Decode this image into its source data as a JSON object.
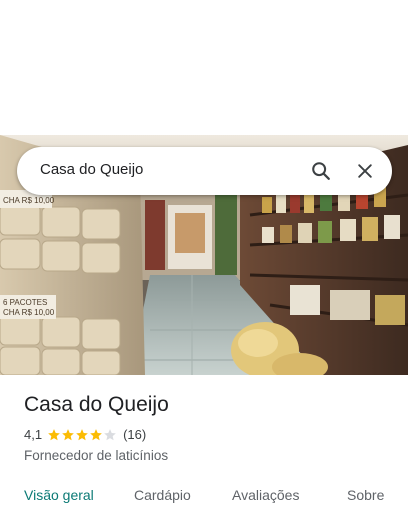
{
  "search": {
    "query": "Casa do Queijo",
    "search_icon": "search-icon",
    "close_icon": "close-icon"
  },
  "photo": {
    "signs": [
      "6 PACOTES",
      "CHA R$ 10,00"
    ],
    "subject": "store-interior-photo"
  },
  "place": {
    "name": "Casa do Queijo",
    "rating": "4,1",
    "rating_value": 4.1,
    "review_count": "(16)",
    "category": "Fornecedor de laticínios"
  },
  "tabs": [
    {
      "label": "Visão geral",
      "active": true
    },
    {
      "label": "Cardápio",
      "active": false
    },
    {
      "label": "Avaliações",
      "active": false
    },
    {
      "label": "Sobre",
      "active": false
    }
  ],
  "colors": {
    "active_tab": "#0b7a75",
    "star_fill": "#fbbc04",
    "star_empty": "#dadce0"
  }
}
